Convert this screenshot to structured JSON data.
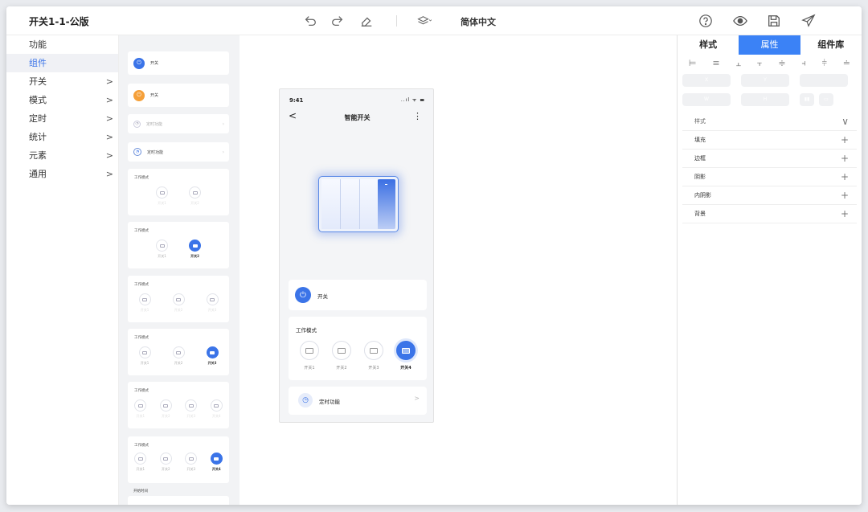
{
  "title": "开关1-1-公版",
  "toolbar": {
    "undo_icon": "undo-icon",
    "redo_icon": "redo-icon",
    "eraser_icon": "eraser-icon",
    "layers_icon": "layers-icon",
    "language": "简体中文",
    "help_icon": "help-icon",
    "preview_icon": "eye-icon",
    "save_icon": "save-icon",
    "send_icon": "send-icon"
  },
  "leftnav": {
    "items": [
      {
        "label": "功能",
        "chevron": ""
      },
      {
        "label": "组件",
        "chevron": ""
      },
      {
        "label": "开关",
        "chevron": ">"
      },
      {
        "label": "模式",
        "chevron": ">"
      },
      {
        "label": "定时",
        "chevron": ">"
      },
      {
        "label": "统计",
        "chevron": ">"
      },
      {
        "label": "元素",
        "chevron": ">"
      },
      {
        "label": "通用",
        "chevron": ">"
      }
    ]
  },
  "palette": {
    "switch_label": "开关",
    "timer_label": "定时功能",
    "mode_title": "工作模式",
    "start_time_label": "开始时间",
    "switch_1": "开关1",
    "switch_2": "开关2",
    "switch_3": "开关3",
    "switch_4": "开关4"
  },
  "phone": {
    "time": "9:41",
    "status": "..ıl ᯤ ▬",
    "back": "<",
    "title": "智能开关",
    "menu": "⋮",
    "switch_label": "开关",
    "mode_title": "工作模式",
    "modes": [
      "开关1",
      "开关2",
      "开关3",
      "开关4"
    ],
    "active_mode_index": 3,
    "timer_label": "定时功能",
    "timer_chevron": ">"
  },
  "rightpanel": {
    "tabs": [
      "样式",
      "属性",
      "组件库"
    ],
    "active_tab_index": 1,
    "align_tools": [
      "⊨",
      "≡",
      "⫠",
      "⫟",
      "≑",
      "⫞",
      "⫩",
      "≐"
    ],
    "fields": {
      "x": "X",
      "y": "Y",
      "w": "W",
      "h": "H"
    },
    "properties_header": "样式",
    "properties": [
      "填充",
      "边框",
      "阴影",
      "内阴影",
      "背景"
    ],
    "expand_icon": "+",
    "collapse_icon": "∨"
  },
  "colors": {
    "accent": "#3b74e8",
    "tab_active": "#3b82f6",
    "orange": "#f5a03a"
  }
}
